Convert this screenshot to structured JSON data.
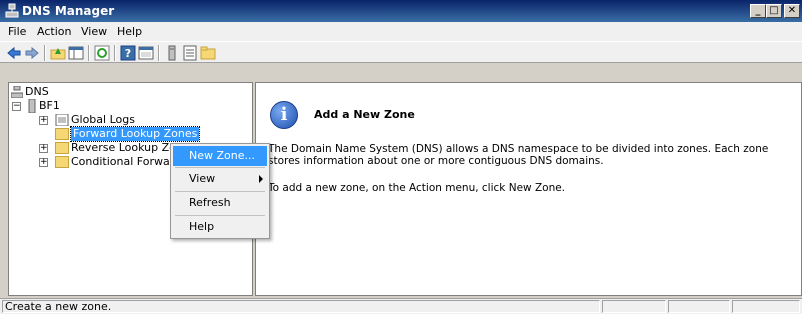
{
  "window": {
    "title": "DNS Manager",
    "minimize_glyph": "_",
    "maximize_glyph": "□",
    "close_glyph": "✕"
  },
  "menubar": {
    "items": [
      {
        "label": "File"
      },
      {
        "label": "Action"
      },
      {
        "label": "View"
      },
      {
        "label": "Help"
      }
    ]
  },
  "toolbar": {
    "buttons": [
      "back-icon",
      "forward-icon",
      "up-folder-icon",
      "show-tree-icon",
      "refresh-icon",
      "help-icon",
      "properties-icon",
      "server-icon",
      "list-icon",
      "folder-icon"
    ]
  },
  "tree": {
    "root": "DNS",
    "server": "BF1",
    "nodes": [
      {
        "label": "Global Logs"
      },
      {
        "label": "Forward Lookup Zones"
      },
      {
        "label": "Reverse Lookup Zone"
      },
      {
        "label": "Conditional Forwarde"
      }
    ]
  },
  "context_menu": {
    "items": [
      {
        "label": "New Zone..."
      },
      {
        "label": "View"
      },
      {
        "label": "Refresh"
      },
      {
        "label": "Help"
      }
    ]
  },
  "details": {
    "heading": "Add a New Zone",
    "para1": "The Domain Name System (DNS) allows a DNS namespace to be divided into zones. Each zone stores information about one or more contiguous DNS domains.",
    "para2": "To add a new zone, on the Action menu, click New Zone."
  },
  "statusbar": {
    "text": "Create a new zone."
  },
  "colors": {
    "title_bar": "#0a246a",
    "selection": "#3399ff",
    "folder": "#f6d776"
  }
}
